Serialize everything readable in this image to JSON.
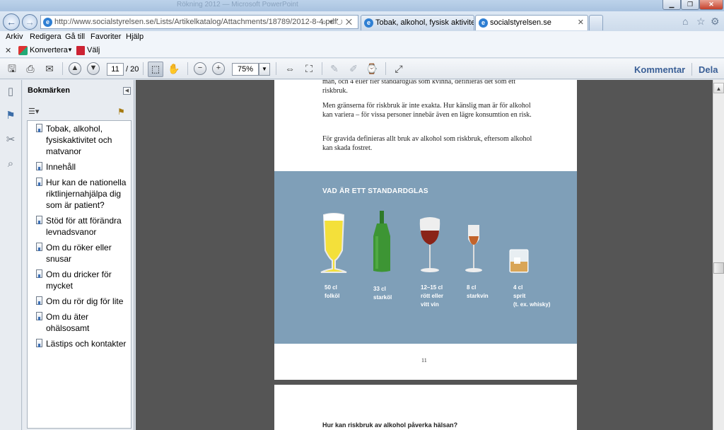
{
  "browser": {
    "title_ghost": "Rökning 2012  —  Microsoft PowerPoint",
    "address_url": "http://www.socialstyrelsen.se/Lists/Artikelkatalog/Attachments/18789/2012-8-4.pdf",
    "tabs": [
      {
        "label": "Tobak, alkohol, fysisk aktivitet ..."
      },
      {
        "label": "socialstyrelsen.se"
      }
    ],
    "menu": [
      "Arkiv",
      "Redigera",
      "Gå till",
      "Favoriter",
      "Hjälp"
    ],
    "convert_label": "Konvertera",
    "select_label": "Välj"
  },
  "reader": {
    "current_page": "11",
    "total_pages": "/ 20",
    "zoom": "75%",
    "comment_label": "Kommentar",
    "share_label": "Dela"
  },
  "bookmarks": {
    "title": "Bokmärken",
    "items": [
      "Tobak, alkohol, fysiskaktivitet och matvanor",
      "Innehåll",
      "Hur kan de nationella riktlinjernahjälpa dig som är patient?",
      "Stöd för att förändra levnadsvanor",
      "Om du röker eller snusar",
      "Om du dricker för mycket",
      "Om du rör dig för lite",
      "Om du äter ohälsosamt",
      "Lästips och kontakter"
    ]
  },
  "document": {
    "para1": "man, och 4 eller fler standardglas som kvinna, definieras det som ett riskbruk.",
    "para2": "Men gränserna för riskbruk är inte exakta. Hur känslig man är för alkohol kan variera – för vissa personer innebär även en lägre konsum­tion en risk.",
    "para3": "För gravida definieras allt bruk av alkohol som riskbruk, eftersom alkohol kan skada fostret.",
    "box_title": "VAD ÄR ETT STANDARDGLAS",
    "glasses": [
      {
        "lines": [
          "50 cl",
          "folköl"
        ]
      },
      {
        "lines": [
          "33 cl",
          "starköl"
        ]
      },
      {
        "lines": [
          "12–15 cl",
          "rött eller",
          "vitt vin"
        ]
      },
      {
        "lines": [
          "8 cl",
          "starkvin"
        ]
      },
      {
        "lines": [
          "4 cl",
          "sprit",
          "(t. ex. whisky)"
        ]
      }
    ],
    "page_number": "11",
    "next_heading": "Hur kan riskbruk av alkohol påverka hälsan?"
  }
}
